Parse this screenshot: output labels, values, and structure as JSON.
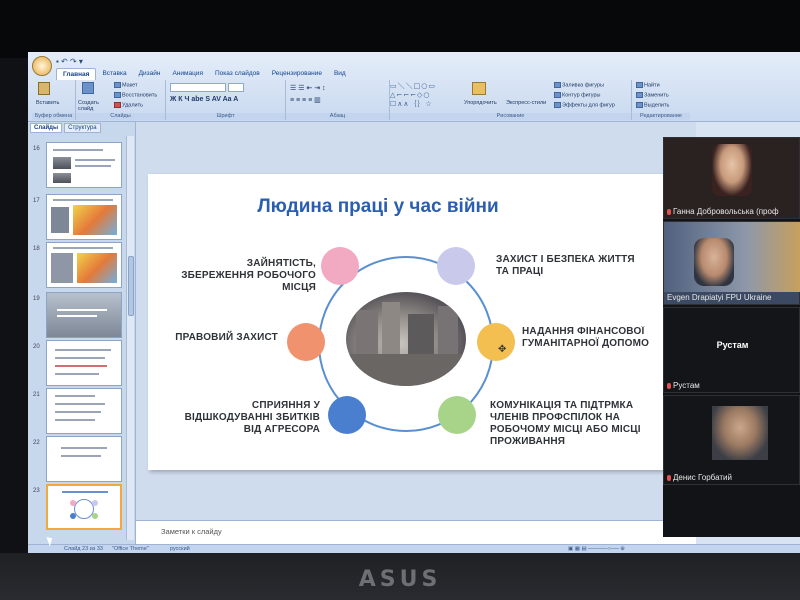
{
  "ribbon": {
    "tabs": [
      "Главная",
      "Вставка",
      "Дизайн",
      "Анимация",
      "Показ слайдов",
      "Рецензирование",
      "Вид"
    ],
    "clipboard": {
      "paste": "Вставить",
      "label": "Буфер обмена"
    },
    "slides": {
      "create": "Создать слайд",
      "layout": "Макет",
      "reset": "Восстановить",
      "delete": "Удалить",
      "label": "Слайды"
    },
    "font": {
      "label": "Шрифт"
    },
    "paragraph": {
      "label": "Абзац"
    },
    "drawing": {
      "arrange": "Упорядочить",
      "quick_styles": "Экспресс-стили",
      "fill": "Заливка фигуры",
      "outline": "Контур фигуры",
      "effects": "Эффекты для фигур",
      "label": "Рисование"
    },
    "editing": {
      "find": "Найти",
      "replace": "Заменить",
      "select": "Выделить",
      "label": "Редактирование"
    }
  },
  "left_pane": {
    "tabs": [
      "Слайды",
      "Структура"
    ],
    "slide_numbers": [
      "16",
      "17",
      "18",
      "19",
      "20",
      "21",
      "22",
      "23"
    ],
    "selected_index": 7
  },
  "slide": {
    "title": "Людина праці у час війни",
    "items": [
      {
        "text": "ЗАЙНЯТІСТЬ, ЗБЕРЕЖЕННЯ РОБОЧОГО МІСЦЯ",
        "color": "#f2a9c2"
      },
      {
        "text": "ЗАХИСТ І БЕЗПЕКА ЖИТТЯ ТА ПРАЦІ",
        "color": "#c9c9ec"
      },
      {
        "text": "ПРАВОВИЙ ЗАХИСТ",
        "color": "#f0926e"
      },
      {
        "text": "НАДАННЯ ФІНАНСОВОЇ ГУМАНІТАРНОЇ ДОПОМО",
        "color": "#f2bf50"
      },
      {
        "text": "СПРИЯННЯ У ВІДШКОДУВАННІ ЗБИТКІВ ВІД АГРЕСОРА",
        "color": "#4a7fd0"
      },
      {
        "text": "КОМУНІКАЦІЯ ТА ПІДТРМКА ЧЛЕНІВ ПРОФСПІЛОК НА РОБОЧОМУ МІСЦІ АБО МІСЦІ ПРОЖИВАННЯ",
        "color": "#a8d48a"
      }
    ]
  },
  "notes": {
    "placeholder": "Заметки к слайду"
  },
  "status": {
    "slide": "Слайд 23 из 33",
    "theme": "\"Office Theme\"",
    "lang": "русский"
  },
  "call": {
    "participants": [
      {
        "name": "Ганна Добровольська (проф"
      },
      {
        "name": "Evgen Drapiatyi FPU Ukraine"
      },
      {
        "name": "Рустам",
        "display": "Рустам"
      },
      {
        "name": "Денис Горбатий"
      }
    ]
  },
  "brand": "ASUS",
  "icons": [
    "office-button-icon",
    "paste-icon",
    "shapes-icon",
    "mic-muted-icon",
    "cursor-icon"
  ]
}
